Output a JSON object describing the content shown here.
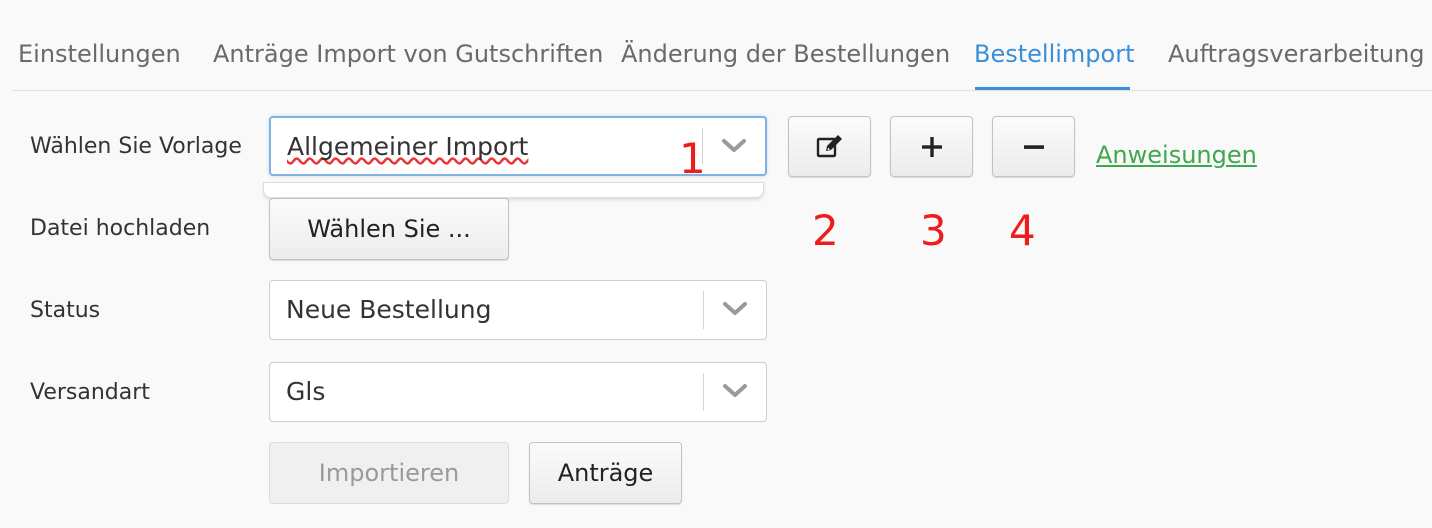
{
  "tabs": [
    {
      "label": "Einstellungen"
    },
    {
      "label": "Anträge Import von Gutschriften"
    },
    {
      "label": "Änderung der Bestellungen"
    },
    {
      "label": "Bestellimport"
    },
    {
      "label": "Auftragsverarbeitung"
    }
  ],
  "active_tab": "Bestellimport",
  "form": {
    "template_label": "Wählen Sie Vorlage",
    "template_value": "Allgemeiner Import",
    "upload_label": "Datei hochladen",
    "upload_button": "Wählen Sie ...",
    "status_label": "Status",
    "status_value": "Neue Bestellung",
    "shipping_label": "Versandart",
    "shipping_value": "Gls"
  },
  "actions": {
    "edit_icon": "edit-icon",
    "add_icon": "plus-icon",
    "remove_icon": "minus-icon",
    "instructions_link": "Anweisungen",
    "import_button": "Importieren",
    "requests_button": "Anträge"
  },
  "markers": [
    "1",
    "2",
    "3",
    "4"
  ],
  "colors": {
    "accent": "#3a8fd8",
    "link": "#3ea84d",
    "marker": "#ee1c1c"
  }
}
